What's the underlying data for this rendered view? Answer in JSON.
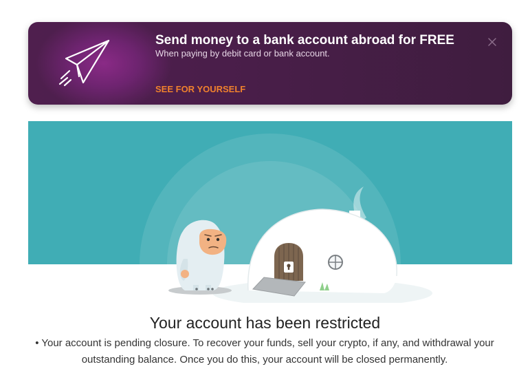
{
  "promo": {
    "title": "Send money to a bank account abroad for FREE",
    "subtitle": "When paying by debit card or bank account.",
    "cta": "SEE FOR YOURSELF",
    "icon": "paper-plane-icon",
    "close_icon": "close-icon",
    "accent_color": "#f0812d",
    "background_color": "#4a1e4a"
  },
  "hero": {
    "illustration": "yeti-igloo-illustration",
    "background_color": "#40adb5"
  },
  "notice": {
    "headline": "Your account has been restricted",
    "message": "• Your account is pending closure. To recover your funds, sell your crypto, if any, and withdrawal your outstanding balance. Once you do this, your account will be closed permanently."
  }
}
